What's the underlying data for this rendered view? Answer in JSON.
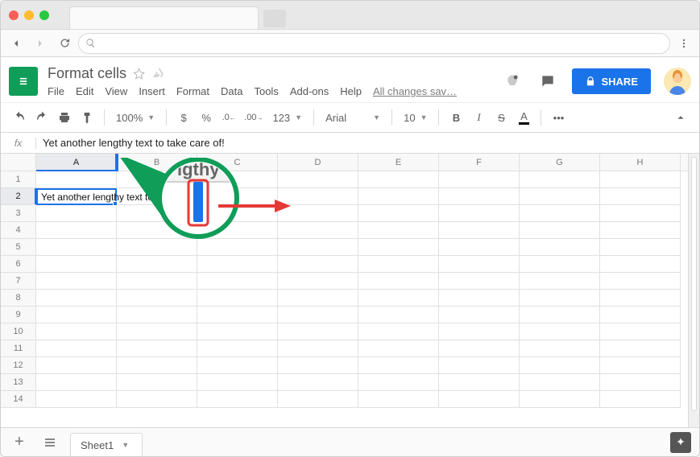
{
  "doc": {
    "title": "Format cells",
    "saved_status": "All changes sav…"
  },
  "menus": [
    "File",
    "Edit",
    "View",
    "Insert",
    "Format",
    "Data",
    "Tools",
    "Add-ons",
    "Help"
  ],
  "toolbar": {
    "zoom": "100%",
    "currency": "$",
    "percent": "%",
    "dec_less": ".0",
    "dec_more": ".00",
    "numfmt": "123",
    "font": "Arial",
    "fontsize": "10",
    "more": "•••"
  },
  "share_label": "SHARE",
  "formula": {
    "fx": "fx",
    "value": "Yet another lengthy text to take care of!"
  },
  "columns": [
    "A",
    "B",
    "C",
    "D",
    "E",
    "F",
    "G",
    "H"
  ],
  "rows": [
    "1",
    "2",
    "3",
    "4",
    "5",
    "6",
    "7",
    "8",
    "9",
    "10",
    "11",
    "12",
    "13",
    "14"
  ],
  "active_cell_text": "Yet another lengthy text to",
  "sheet_tab": "Sheet1",
  "zoom_text": "igthy"
}
